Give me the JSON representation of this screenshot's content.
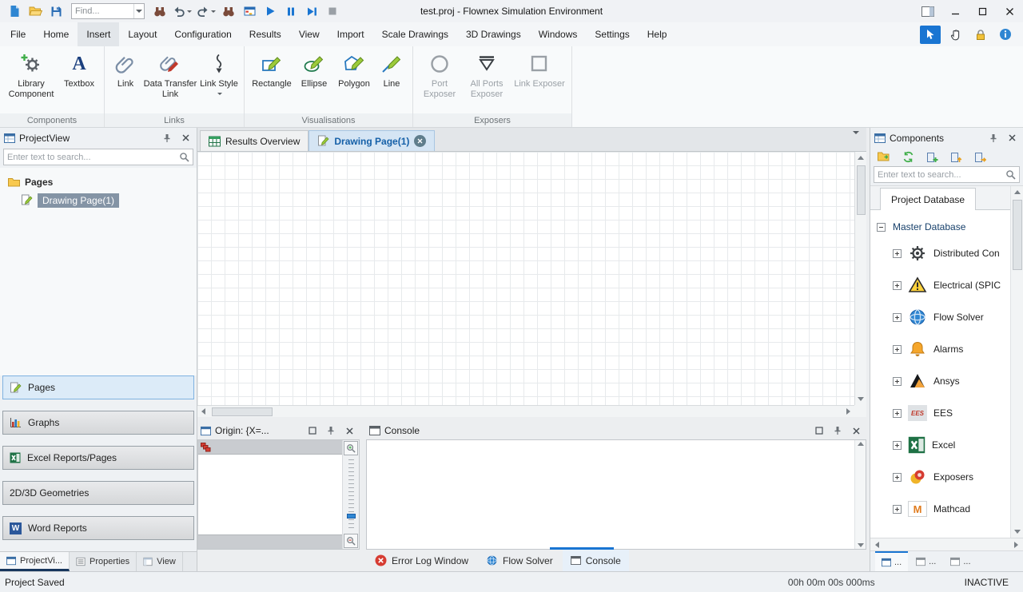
{
  "titlebar": {
    "title": "test.proj - Flownex Simulation Environment",
    "find_placeholder": "Find..."
  },
  "menubar": {
    "active": "Insert",
    "items": [
      {
        "label": "File"
      },
      {
        "label": "Home"
      },
      {
        "label": "Insert"
      },
      {
        "label": "Layout"
      },
      {
        "label": "Configuration"
      },
      {
        "label": "Results"
      },
      {
        "label": "View"
      },
      {
        "label": "Import"
      },
      {
        "label": "Scale Drawings"
      },
      {
        "label": "3D Drawings"
      },
      {
        "label": "Windows"
      },
      {
        "label": "Settings"
      },
      {
        "label": "Help"
      }
    ]
  },
  "ribbon": {
    "groups": [
      {
        "label": "Components",
        "items": [
          {
            "label": "Library Component"
          },
          {
            "label": "Textbox"
          }
        ]
      },
      {
        "label": "Links",
        "items": [
          {
            "label": "Link"
          },
          {
            "label": "Data Transfer Link"
          },
          {
            "label": "Link Style"
          }
        ]
      },
      {
        "label": "Visualisations",
        "items": [
          {
            "label": "Rectangle"
          },
          {
            "label": "Ellipse"
          },
          {
            "label": "Polygon"
          },
          {
            "label": "Line"
          }
        ]
      },
      {
        "label": "Exposers",
        "items": [
          {
            "label": "Port Exposer"
          },
          {
            "label": "All Ports Exposer"
          },
          {
            "label": "Link Exposer"
          }
        ]
      }
    ]
  },
  "project_view": {
    "title": "ProjectView",
    "search_placeholder": "Enter text to search...",
    "tree": {
      "root": "Pages",
      "page": "Drawing Page(1)"
    },
    "nav_buttons": [
      {
        "label": "Pages"
      },
      {
        "label": "Graphs"
      },
      {
        "label": "Excel Reports/Pages"
      },
      {
        "label": "2D/3D Geometries"
      },
      {
        "label": "Word Reports"
      }
    ],
    "bottom_tabs": [
      {
        "label": "ProjectVi..."
      },
      {
        "label": "Properties"
      },
      {
        "label": "View"
      }
    ]
  },
  "document_tabs": [
    {
      "label": "Results Overview"
    },
    {
      "label": "Drawing Page(1)"
    }
  ],
  "origin_panel": {
    "title": "Origin: {X=..."
  },
  "console_panel": {
    "title": "Console"
  },
  "output_tabs": [
    {
      "label": "Error Log Window"
    },
    {
      "label": "Flow Solver"
    },
    {
      "label": "Console"
    }
  ],
  "components_panel": {
    "title": "Components",
    "search_placeholder": "Enter text to search...",
    "database_tab": "Project Database",
    "root": "Master Database",
    "items": [
      {
        "label": "Distributed Con"
      },
      {
        "label": "Electrical (SPIC"
      },
      {
        "label": "Flow Solver"
      },
      {
        "label": "Alarms"
      },
      {
        "label": "Ansys"
      },
      {
        "label": "EES"
      },
      {
        "label": "Excel"
      },
      {
        "label": "Exposers"
      },
      {
        "label": "Mathcad"
      }
    ],
    "mini_tabs": [
      {
        "label": "..."
      },
      {
        "label": "..."
      },
      {
        "label": "..."
      }
    ]
  },
  "statusbar": {
    "left": "Project Saved",
    "timer": "00h 00m 00s 000ms",
    "state": "INACTIVE"
  },
  "glyphs": {
    "textbox": "A",
    "word": "W",
    "mathcad": "M",
    "ees": "EES"
  },
  "colors": {
    "accent": "#1975d2",
    "active_doc_tab_bg": "#d5e5f4",
    "active_doc_tab_text": "#1560a8",
    "selection_bg": "#8494a5"
  }
}
